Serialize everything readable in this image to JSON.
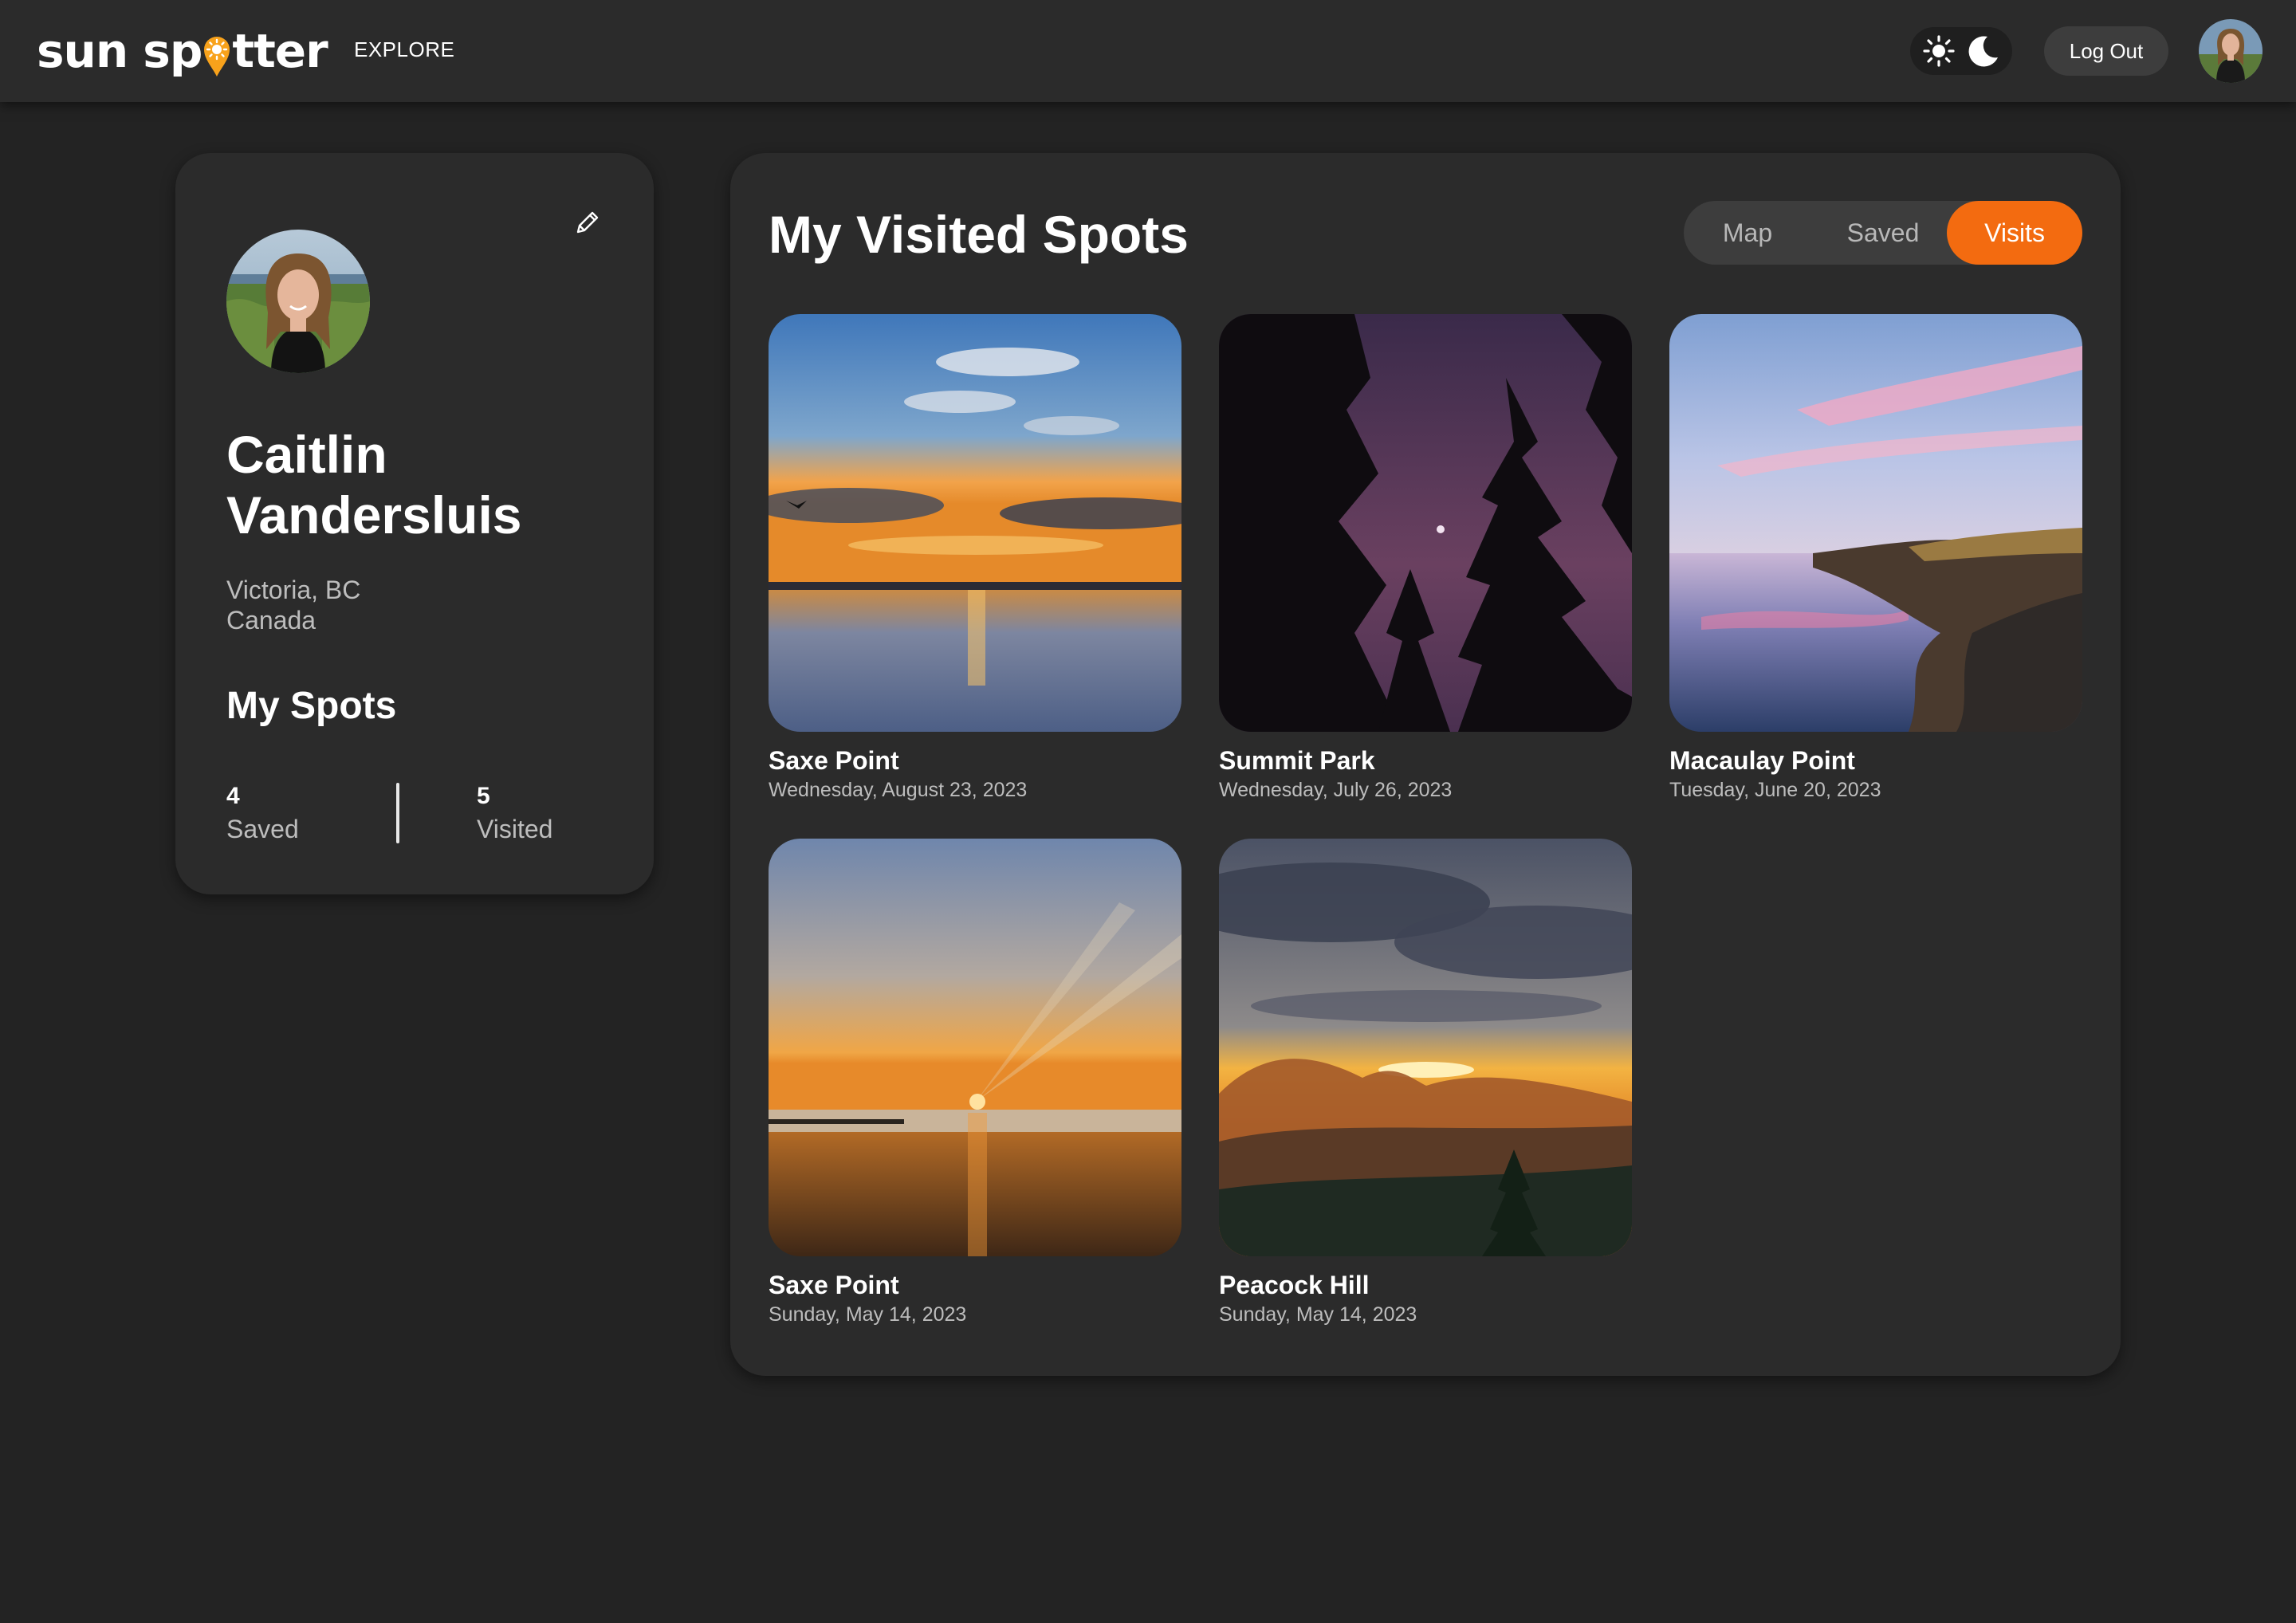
{
  "header": {
    "logo_left": "sun sp",
    "logo_right": "tter",
    "nav_explore": "EXPLORE",
    "logout_label": "Log Out",
    "theme_light_icon": "sun-icon",
    "theme_dark_icon": "moon-icon"
  },
  "profile": {
    "name": "Caitlin Vandersluis",
    "city": "Victoria, BC",
    "country": "Canada",
    "spots_heading": "My Spots",
    "saved_count": "4",
    "saved_label": "Saved",
    "visited_count": "5",
    "visited_label": "Visited",
    "edit_icon": "pencil-icon"
  },
  "panel": {
    "title": "My Visited Spots",
    "tabs": [
      {
        "label": "Map",
        "active": false
      },
      {
        "label": "Saved",
        "active": false
      },
      {
        "label": "Visits",
        "active": true
      }
    ]
  },
  "visits": [
    {
      "place": "Saxe Point",
      "date": "Wednesday, August 23, 2023"
    },
    {
      "place": "Summit Park",
      "date": "Wednesday, July 26, 2023"
    },
    {
      "place": "Macaulay Point",
      "date": "Tuesday, June 20, 2023"
    },
    {
      "place": "Saxe Point",
      "date": "Sunday, May 14, 2023"
    },
    {
      "place": "Peacock Hill",
      "date": "Sunday, May 14, 2023"
    }
  ],
  "colors": {
    "background": "#232323",
    "surface": "#2b2b2b",
    "accent": "#f36b10",
    "muted_text": "#bdbdbd"
  }
}
